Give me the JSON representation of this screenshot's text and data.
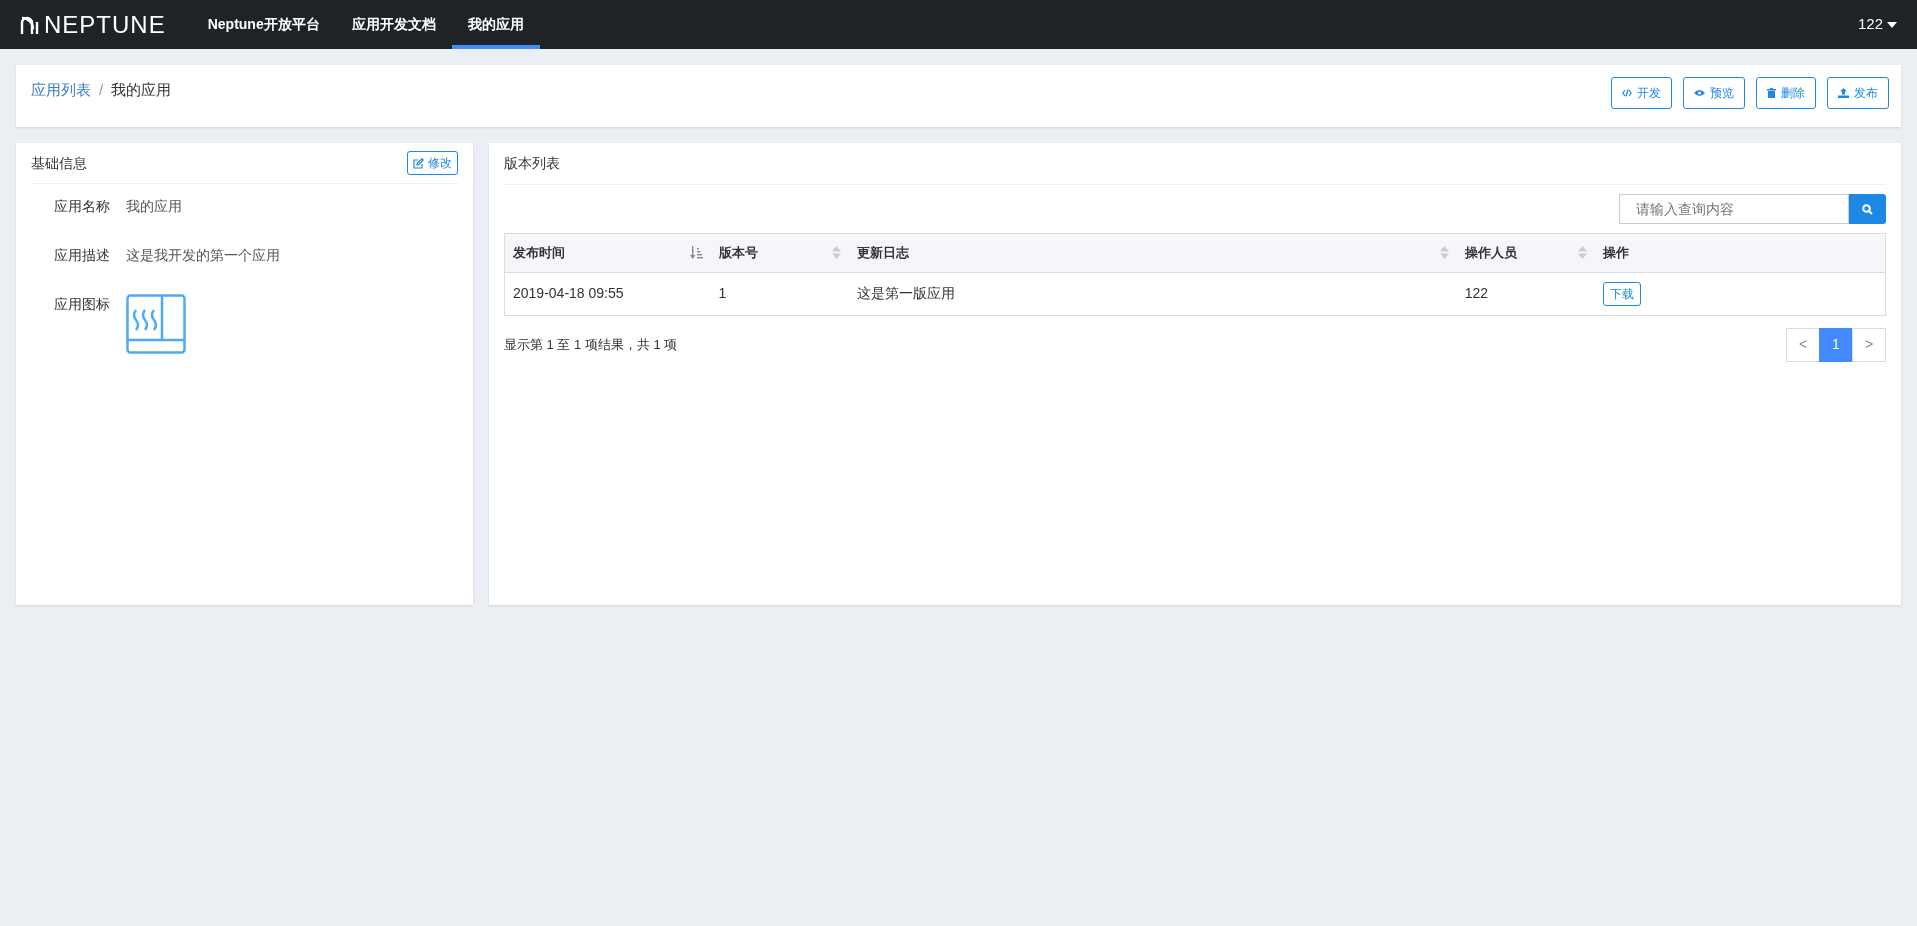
{
  "navbar": {
    "brand": "NEPTUNE",
    "items": [
      {
        "label": "Neptune开放平台",
        "selected": false
      },
      {
        "label": "应用开发文档",
        "selected": false
      },
      {
        "label": "我的应用",
        "selected": true
      }
    ],
    "user": "122"
  },
  "breadcrumb": {
    "items": [
      "应用列表",
      "我的应用"
    ],
    "separator": "/"
  },
  "actions": [
    {
      "kind": "code",
      "label": "开发"
    },
    {
      "kind": "eye",
      "label": "预览"
    },
    {
      "kind": "trash",
      "label": "删除"
    },
    {
      "kind": "upload",
      "label": "发布"
    }
  ],
  "basic_info": {
    "title": "基础信息",
    "edit_button": "修改",
    "fields": [
      {
        "kind": "text",
        "label": "应用名称",
        "value": "我的应用"
      },
      {
        "kind": "text",
        "label": "应用描述",
        "value": "这是我开发的第一个应用"
      },
      {
        "kind": "icon",
        "label": "应用图标"
      }
    ]
  },
  "versions": {
    "title": "版本列表",
    "search": {
      "placeholder": "请输入查询内容"
    },
    "columns": [
      {
        "label": "发布时间",
        "sortable": true,
        "sorted": true
      },
      {
        "label": "版本号",
        "sortable": true,
        "sorted": false
      },
      {
        "label": "更新日志",
        "sortable": true,
        "sorted": false
      },
      {
        "label": "操作人员",
        "sortable": true,
        "sorted": false
      },
      {
        "label": "操作",
        "sortable": false
      }
    ],
    "rows": [
      {
        "time": "2019-04-18 09:55",
        "version": "1",
        "log": "这是第一版应用",
        "operator": "122",
        "action": "下载"
      }
    ],
    "summary": "显示第 1 至 1 项结果，共 1 项",
    "pagination": [
      {
        "label": "<",
        "selected": false
      },
      {
        "label": "1",
        "selected": true
      },
      {
        "label": ">",
        "selected": false
      }
    ]
  }
}
